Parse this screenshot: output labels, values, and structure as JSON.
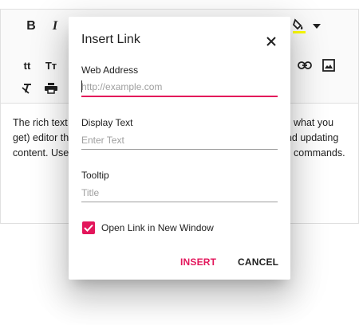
{
  "editor": {
    "content_lines": [
      [
        "The rich text",
        "what you"
      ],
      [
        "get) editor th",
        "and updating"
      ],
      [
        "content. Use",
        "commands."
      ]
    ]
  },
  "dialog": {
    "title": "Insert Link",
    "fields": [
      {
        "label": "Web Address",
        "value": "",
        "placeholder": "http://example.com"
      },
      {
        "label": "Display Text",
        "value": "",
        "placeholder": "Enter Text"
      },
      {
        "label": "Tooltip",
        "value": "",
        "placeholder": "Title"
      }
    ],
    "checkbox": {
      "label": "Open Link in New Window",
      "checked": true
    },
    "buttons": {
      "insert": "INSERT",
      "cancel": "CANCEL"
    }
  },
  "toolbar": {
    "icons": [
      "bold-icon",
      "italic-icon",
      "background-color-icon",
      "dropdown-icon",
      "lowercase-icon",
      "uppercase-icon",
      "link-icon",
      "image-icon",
      "clear-format-icon",
      "print-icon"
    ]
  },
  "colors": {
    "accent": "#e3165b",
    "highlight": "#ffff00"
  }
}
